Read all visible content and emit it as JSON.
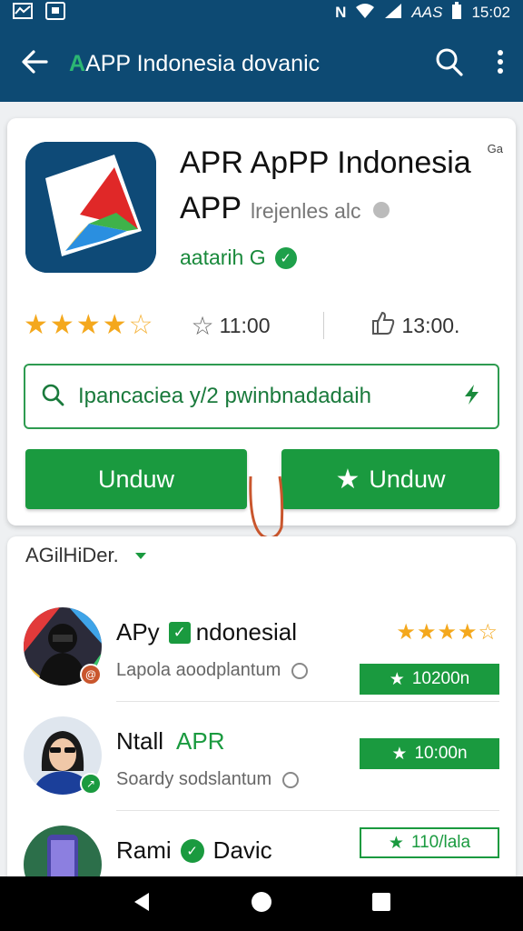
{
  "status_bar": {
    "network_label": "N",
    "signal_text": "AAS",
    "time": "15:02"
  },
  "app_bar": {
    "title_prefix": "A",
    "title_rest": "APP Indonesia dovanic",
    "accent_color": "#2bb673",
    "background": "#0d4a73"
  },
  "app_header": {
    "name_line1": "APR ApPP Indonesia",
    "name_line2": "APP",
    "name_sub": "lrejenles alc",
    "developer": "aatarih G",
    "corner_label": "Ga",
    "rating_stars": 4.5,
    "downloads_value": "11:00",
    "likes_value": "13:00.",
    "search_text": "Ipancaciea  y/2 pwinbnadadaih",
    "button_primary_label": "Unduw",
    "button_secondary_label": "Unduw",
    "brand_green": "#1a9a3f"
  },
  "list": {
    "section_title": "AGilHiDer.",
    "items": [
      {
        "title": "APy",
        "title_suffix": "ndonesial",
        "subtitle": "Lapola aoodplantum",
        "stars": 4.5,
        "button_label": "10200n",
        "button_style": "filled"
      },
      {
        "title": "Ntall",
        "title_accent": "APR",
        "subtitle": "Soardy sodslantum",
        "stars": 0,
        "button_label": "10:00n",
        "button_style": "filled"
      },
      {
        "title": "Rami",
        "title_suffix": "Davic",
        "subtitle": "",
        "stars": 0,
        "button_label": "110/lala",
        "button_style": "outline"
      }
    ]
  }
}
